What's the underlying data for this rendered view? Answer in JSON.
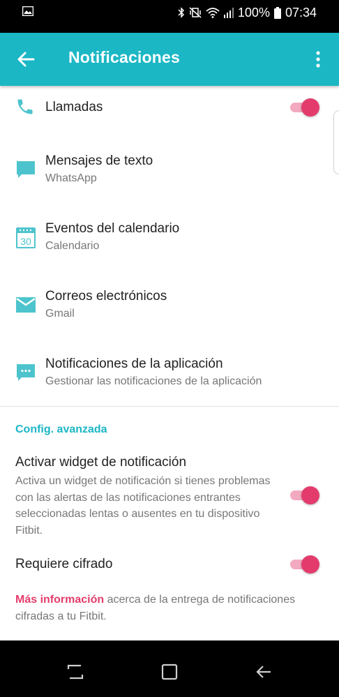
{
  "status_bar": {
    "battery": "100%",
    "time": "07:34",
    "icons": [
      "gallery-icon",
      "bluetooth-icon",
      "vibrate-icon",
      "wifi-icon",
      "signal-icon",
      "battery-icon"
    ]
  },
  "app_bar": {
    "title": "Notificaciones",
    "back_icon": "arrow-left-icon",
    "menu_icon": "more-vertical-icon"
  },
  "notification_items": [
    {
      "title": "Llamadas",
      "subtitle": "",
      "icon": "phone-icon",
      "toggle_on": true
    },
    {
      "title": "Mensajes de texto",
      "subtitle": "WhatsApp",
      "icon": "message-icon"
    },
    {
      "title": "Eventos del calendario",
      "subtitle": "Calendario",
      "icon": "calendar-icon",
      "icon_text": "30"
    },
    {
      "title": "Correos electrónicos",
      "subtitle": "Gmail",
      "icon": "mail-icon"
    },
    {
      "title": "Notificaciones de la aplicación",
      "subtitle": "Gestionar las notificaciones de la aplicación",
      "icon": "app-notification-icon"
    }
  ],
  "advanced": {
    "header": "Config. avanzada",
    "widget_title": "Activar widget de notificación",
    "widget_description": "Activa un widget de notificación si tienes problemas con las alertas de las notificaciones entrantes seleccionadas lentas o ausentes en tu dispositivo Fitbit.",
    "widget_toggle_on": true,
    "encryption_title": "Requiere cifrado",
    "encryption_toggle_on": true,
    "more_info_link": "Más información",
    "more_info_text": " acerca de la entrega de notificaciones cifradas a tu Fitbit."
  },
  "colors": {
    "accent": "#1bb7c5",
    "toggle_thumb": "#e33c6c",
    "toggle_track": "#f3aac0",
    "link": "#e33c6c"
  },
  "nav_bar": {
    "buttons": [
      "recents-icon",
      "home-icon",
      "back-icon"
    ]
  }
}
